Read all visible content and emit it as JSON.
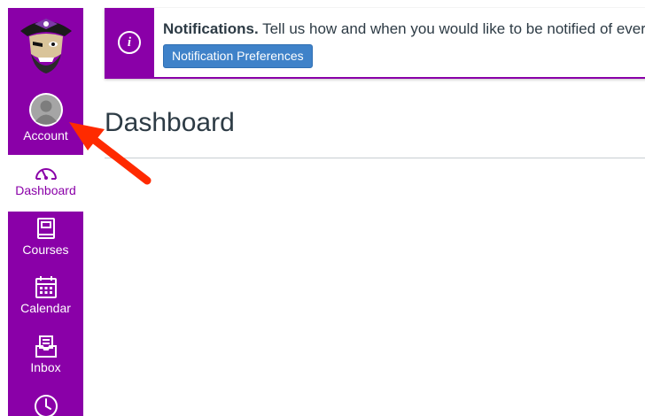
{
  "nav": {
    "account_label": "Account",
    "dashboard_label": "Dashboard",
    "courses_label": "Courses",
    "calendar_label": "Calendar",
    "inbox_label": "Inbox"
  },
  "notification": {
    "title": "Notifications.",
    "message": "Tell us how and when you would like to be notified of ever",
    "button_label": "Notification Preferences",
    "info_glyph": "i"
  },
  "main": {
    "page_title": "Dashboard"
  },
  "colors": {
    "brand_purple": "#8a00a8",
    "button_blue": "#3f82c9",
    "annotation_red": "#ff2a00"
  }
}
